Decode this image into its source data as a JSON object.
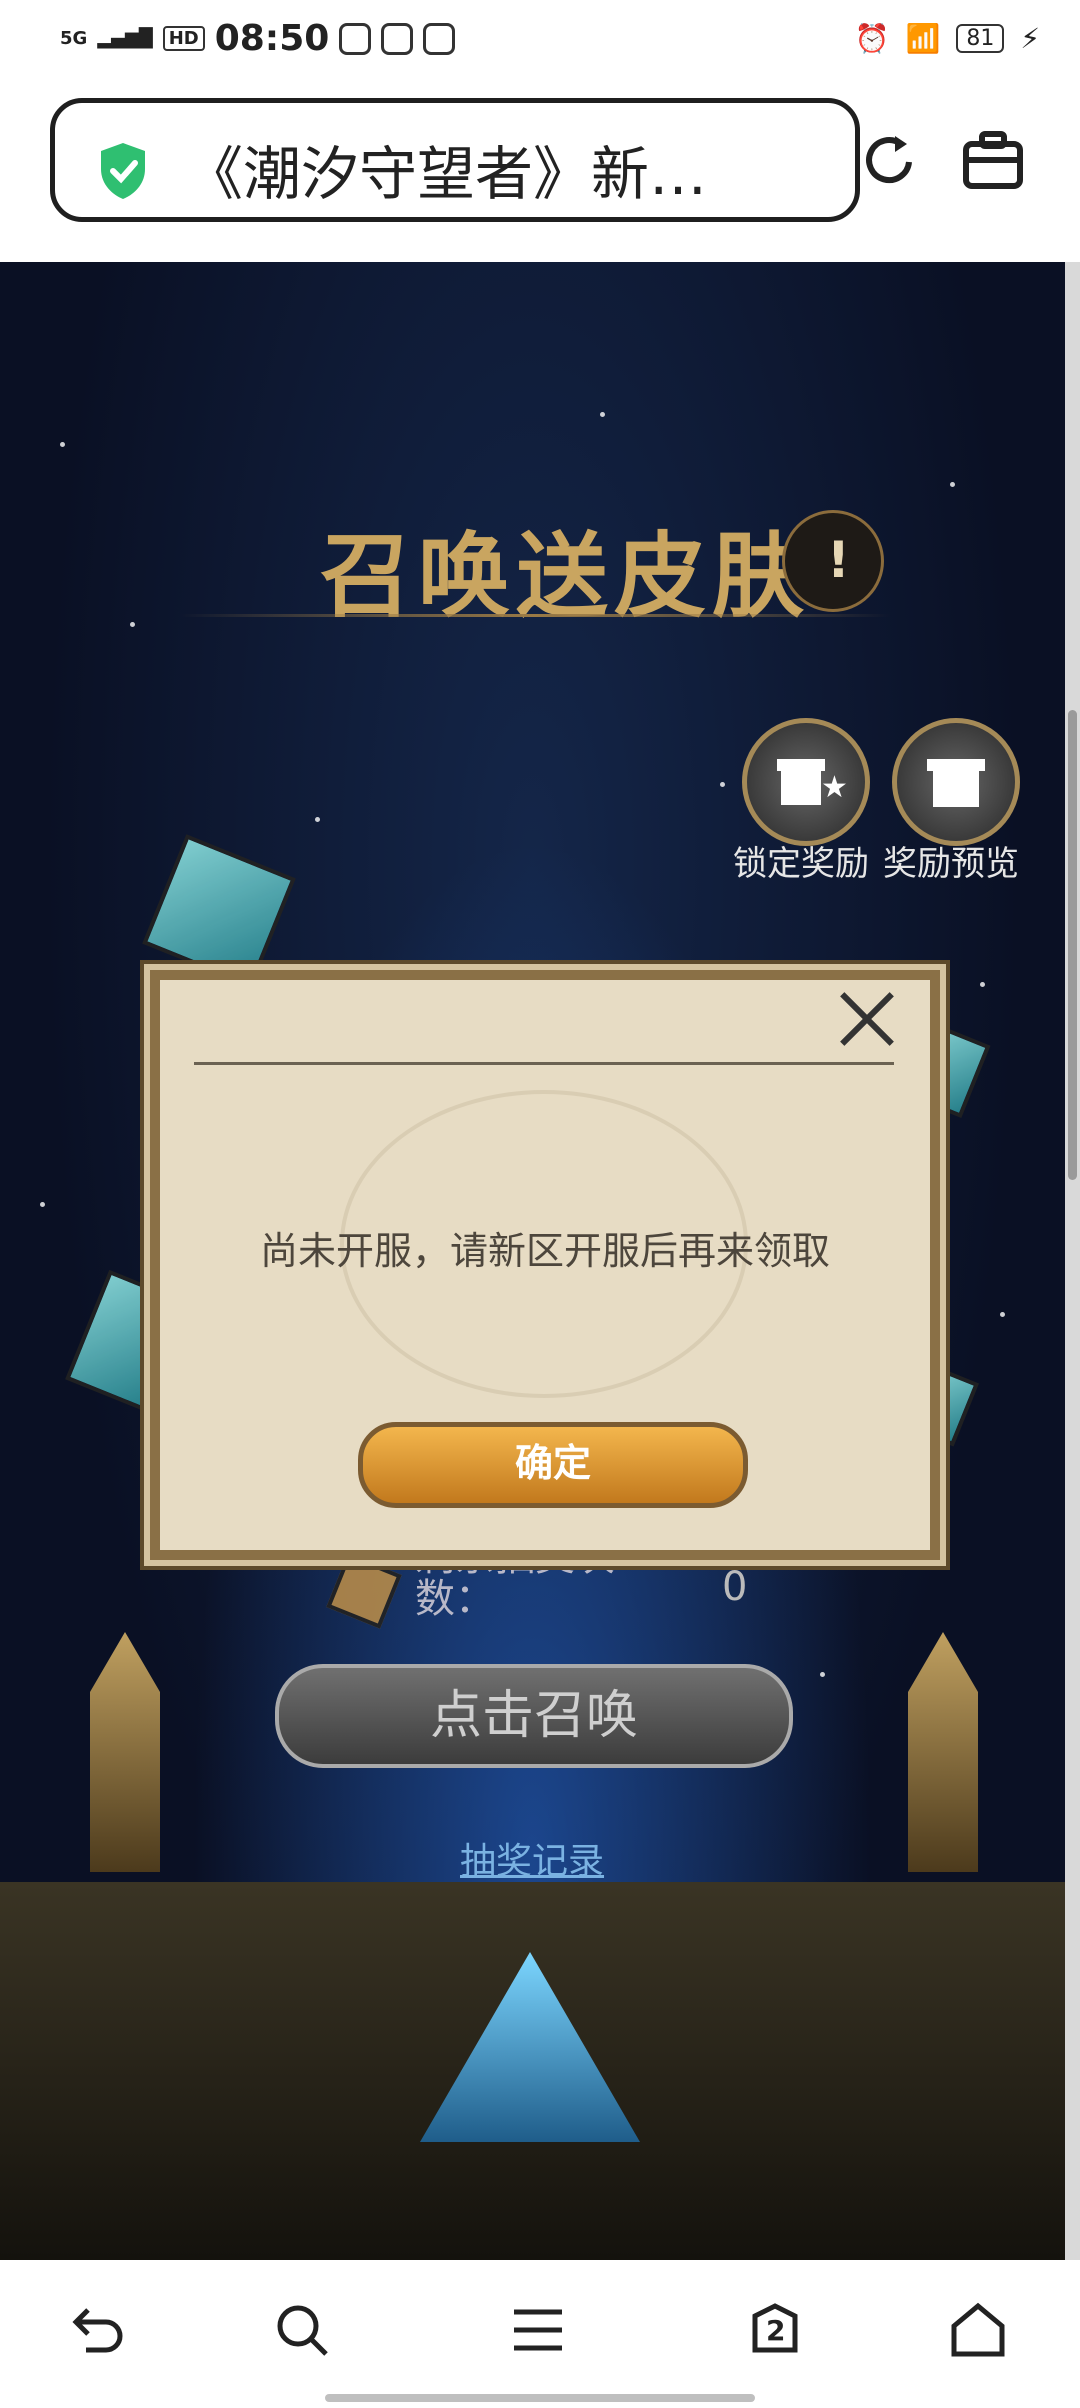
{
  "status_bar": {
    "network": "5G",
    "hd": "HD",
    "time": "08:50",
    "battery": "81",
    "icons": [
      "alarm-icon",
      "wifi-icon",
      "battery-icon",
      "charging-icon"
    ]
  },
  "browser": {
    "url_title": "《潮汐守望者》新…",
    "icons": [
      "security-shield-icon",
      "refresh-icon",
      "toolbox-icon"
    ]
  },
  "game": {
    "title": "召唤送皮肤",
    "info_icon": "!",
    "side_buttons": [
      {
        "label": "锁定奖励",
        "icon": "gift-star-icon"
      },
      {
        "label": "奖励预览",
        "icon": "gift-icon"
      }
    ],
    "remaining_label": "剩余抽奖次数：",
    "remaining_count": "0",
    "summon_button": "点击召唤",
    "record_link": "抽奖记录"
  },
  "dialog": {
    "message": "尚未开服，请新区开服后再来领取",
    "confirm": "确定",
    "close_icon": "close-icon"
  },
  "bottom_nav": {
    "tabs_count": "2",
    "items": [
      "back-icon",
      "search-icon",
      "menu-icon",
      "tabs-icon",
      "home-icon"
    ]
  },
  "colors": {
    "accent_gold": "#c9a560",
    "dialog_bg": "#e7dcc4",
    "button_orange": "#e6a03b",
    "link_blue": "#7ab2e2"
  }
}
